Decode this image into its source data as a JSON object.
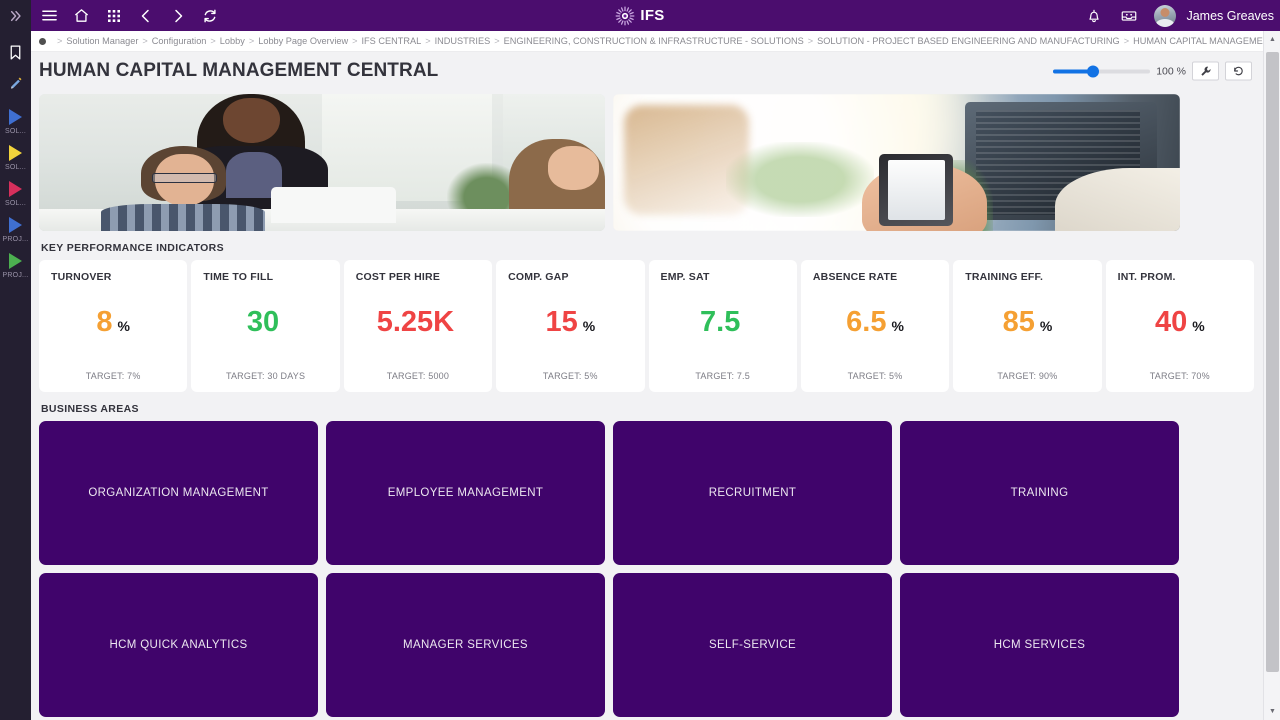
{
  "app_bar": {
    "rail_toggle_icon": "chevron-double-right-icon",
    "icons": [
      {
        "name": "hamburger-menu-icon",
        "label": "Menu"
      },
      {
        "name": "home-icon",
        "label": "Home"
      },
      {
        "name": "app-grid-icon",
        "label": "Apps"
      },
      {
        "name": "back-arrow-icon",
        "label": "Back"
      },
      {
        "name": "forward-arrow-icon",
        "label": "Forward"
      },
      {
        "name": "refresh-icon",
        "label": "Refresh"
      }
    ],
    "logo_text": "IFS",
    "notification_icon": "bell-icon",
    "inbox_icon": "inbox-tray-icon",
    "user_name": "James Greaves"
  },
  "left_rail": {
    "top_buttons": [
      {
        "name": "bookmark-icon",
        "label": "Bookmarks"
      },
      {
        "name": "pencil-icon",
        "label": "Edit"
      }
    ],
    "items": [
      {
        "label": "SOL...",
        "color": "#3f6fd1"
      },
      {
        "label": "SOL...",
        "color": "#f2d33c"
      },
      {
        "label": "SOL...",
        "color": "#d62f5c"
      },
      {
        "label": "PROJ...",
        "color": "#3f6fd1"
      },
      {
        "label": "PROJ...",
        "color": "#4caf50"
      }
    ]
  },
  "breadcrumb": {
    "separator": ">",
    "items": [
      "Solution Manager",
      "Configuration",
      "Lobby",
      "Lobby Page Overview",
      "IFS CENTRAL",
      "INDUSTRIES",
      "ENGINEERING, CONSTRUCTION & INFRASTRUCTURE - SOLUTIONS",
      "SOLUTION - PROJECT BASED ENGINEERING AND MANUFACTURING",
      "HUMAN CAPITAL MANAGEMENT CENTRAL"
    ],
    "refresh_icon": "refresh-icon"
  },
  "title_bar": {
    "title": "HUMAN CAPITAL MANAGEMENT CENTRAL",
    "zoom_percent": "100 %",
    "zoom_value": 100,
    "tools": [
      {
        "name": "wrench-icon",
        "label": "Configure"
      },
      {
        "name": "reset-icon",
        "label": "Reset"
      }
    ]
  },
  "hero": {
    "left_image_alt": "office-meeting-photo",
    "right_image_alt": "hand-holding-phone-photo"
  },
  "sections": {
    "kpi_heading": "KEY PERFORMANCE INDICATORS",
    "business_heading": "BUSINESS AREAS"
  },
  "kpis": [
    {
      "title": "TURNOVER",
      "value": "8",
      "unit": "%",
      "color": "#f5a033",
      "target": "TARGET: 7%"
    },
    {
      "title": "TIME TO FILL",
      "value": "30",
      "unit": "",
      "color": "#2fbf5a",
      "target": "TARGET: 30 DAYS"
    },
    {
      "title": "COST PER HIRE",
      "value": "5.25K",
      "unit": "",
      "color": "#ef4444",
      "target": "TARGET: 5000"
    },
    {
      "title": "COMP. GAP",
      "value": "15",
      "unit": "%",
      "color": "#ef4444",
      "target": "TARGET: 5%"
    },
    {
      "title": "EMP. SAT",
      "value": "7.5",
      "unit": "",
      "color": "#2fbf5a",
      "target": "TARGET: 7.5"
    },
    {
      "title": "ABSENCE RATE",
      "value": "6.5",
      "unit": "%",
      "color": "#f5a033",
      "target": "TARGET: 5%"
    },
    {
      "title": "TRAINING EFF.",
      "value": "85",
      "unit": "%",
      "color": "#f5a033",
      "target": "TARGET: 90%"
    },
    {
      "title": "INT. PROM.",
      "value": "40",
      "unit": "%",
      "color": "#ef4444",
      "target": "TARGET: 70%"
    }
  ],
  "business_areas": [
    {
      "label": "ORGANIZATION MANAGEMENT"
    },
    {
      "label": "EMPLOYEE MANAGEMENT"
    },
    {
      "label": "RECRUITMENT"
    },
    {
      "label": "TRAINING"
    },
    {
      "label": "HCM QUICK ANALYTICS"
    },
    {
      "label": "MANAGER SERVICES"
    },
    {
      "label": "SELF-SERVICE"
    },
    {
      "label": "HCM SERVICES"
    }
  ],
  "scrollbar": {
    "up_arrow": "▲",
    "down_arrow": "▼"
  },
  "colors": {
    "brand_purple": "#4b0d6e",
    "rail_dark": "#241f31",
    "tile_purple": "#40046b",
    "accent_blue": "#1272e4"
  }
}
